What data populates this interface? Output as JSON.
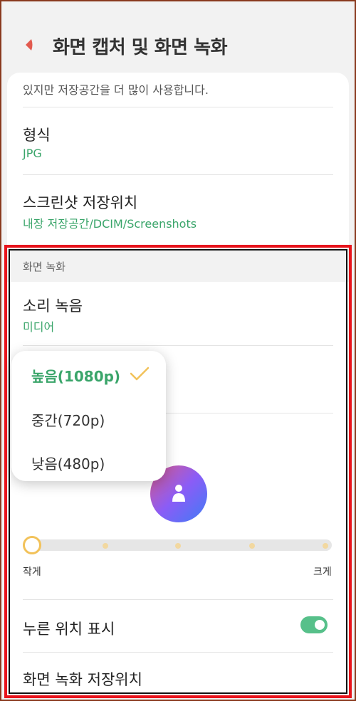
{
  "header": {
    "title": "화면 캡처 및 화면 녹화"
  },
  "screenshots": {
    "description_tail": "있지만 저장공간을 더 많이 사용합니다.",
    "format": {
      "label": "형식",
      "value": "JPG"
    },
    "save_location": {
      "label": "스크린샷 저장위치",
      "value": "내장 저장공간/DCIM/Screenshots"
    }
  },
  "screen_recording": {
    "section_label": "화면 녹화",
    "sound": {
      "label": "소리 녹음",
      "value": "미디어"
    },
    "quality_popup": {
      "options": [
        "높음(1080p)",
        "중간(720p)",
        "낮음(480p)"
      ],
      "selected_index": 0
    },
    "selfie_size": {
      "min_label": "작게",
      "max_label": "크게",
      "level": 0,
      "steps": 5
    },
    "show_touches": {
      "label": "누른 위치 표시",
      "enabled": true
    },
    "save_location_label": "화면 녹화 저장위치"
  },
  "colors": {
    "accent_green": "#3aa56a",
    "toggle_green": "#57c08a",
    "slider_accent": "#f2c25a",
    "highlight_red": "#e8141c"
  }
}
